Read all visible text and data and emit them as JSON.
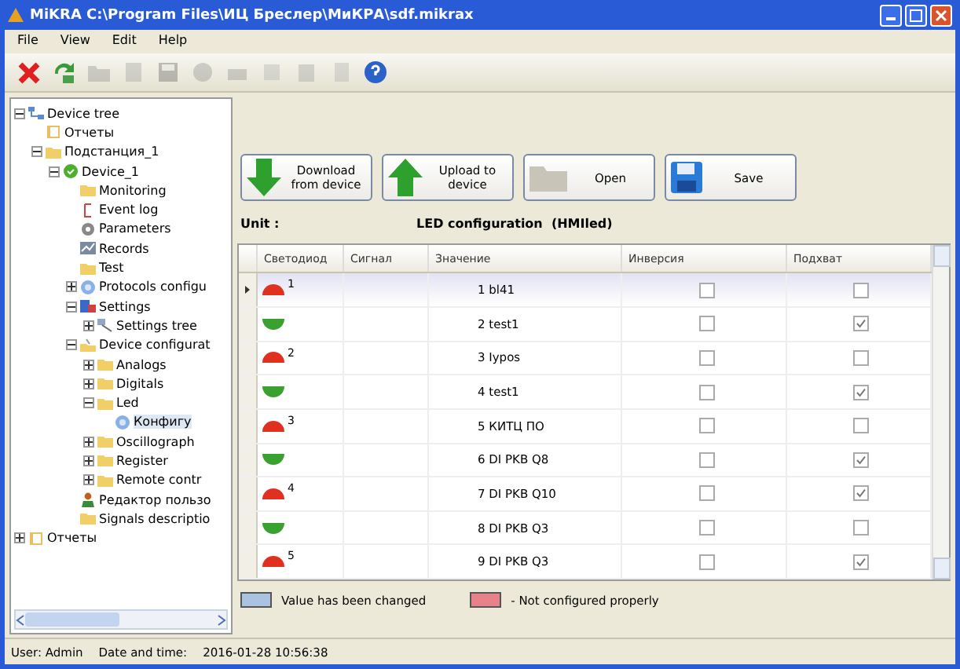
{
  "window": {
    "title": "MiKRA C:\\Program Files\\ИЦ Бреслер\\МиКРА\\sdf.mikrax"
  },
  "menu": [
    "File",
    "View",
    "Edit",
    "Help"
  ],
  "toolbar": [
    {
      "kind": "delete",
      "disabled": false
    },
    {
      "kind": "refresh",
      "disabled": false
    },
    {
      "kind": "open",
      "disabled": true
    },
    {
      "kind": "edit",
      "disabled": true
    },
    {
      "kind": "save",
      "disabled": true
    },
    {
      "kind": "back",
      "disabled": true
    },
    {
      "kind": "print",
      "disabled": true
    },
    {
      "kind": "copy",
      "disabled": true
    },
    {
      "kind": "paste",
      "disabled": true
    },
    {
      "kind": "page",
      "disabled": true
    },
    {
      "kind": "help",
      "disabled": false
    }
  ],
  "tree": [
    {
      "label": "Device tree",
      "kind": "network",
      "expanded": true,
      "children": [
        {
          "label": "Отчеты",
          "kind": "report"
        },
        {
          "label": "Подстанция_1",
          "kind": "folder",
          "expanded": true,
          "children": [
            {
              "label": "Device_1",
              "kind": "device",
              "expanded": true,
              "children": [
                {
                  "label": "Monitoring",
                  "kind": "folder"
                },
                {
                  "label": "Event log",
                  "kind": "log"
                },
                {
                  "label": "Parameters",
                  "kind": "gear"
                },
                {
                  "label": "Records",
                  "kind": "records"
                },
                {
                  "label": "Test",
                  "kind": "folder"
                },
                {
                  "label": "Protocols configu",
                  "kind": "globe",
                  "expanded": false
                },
                {
                  "label": "Settings",
                  "kind": "settings",
                  "expanded": true,
                  "children": [
                    {
                      "label": "Settings tree",
                      "kind": "tool",
                      "expanded": false
                    }
                  ]
                },
                {
                  "label": "Device configurat",
                  "kind": "config",
                  "expanded": true,
                  "children": [
                    {
                      "label": "Analogs",
                      "kind": "folder",
                      "expanded": false
                    },
                    {
                      "label": "Digitals",
                      "kind": "folder",
                      "expanded": false
                    },
                    {
                      "label": "Led",
                      "kind": "folder",
                      "expanded": true,
                      "children": [
                        {
                          "label": "Конфигу",
                          "kind": "globe",
                          "selected": true
                        }
                      ]
                    },
                    {
                      "label": "Oscillograph",
                      "kind": "folder",
                      "expanded": false
                    },
                    {
                      "label": "Register",
                      "kind": "folder",
                      "expanded": false
                    },
                    {
                      "label": "Remote contr",
                      "kind": "folder",
                      "expanded": false
                    }
                  ]
                },
                {
                  "label": "Редактор пользо",
                  "kind": "user"
                },
                {
                  "label": "Signals descriptio",
                  "kind": "folder"
                }
              ]
            }
          ]
        }
      ]
    },
    {
      "label": "Отчеты",
      "kind": "report",
      "expanded": false
    }
  ],
  "buttons": [
    {
      "kind": "download",
      "label": "Download from device"
    },
    {
      "kind": "upload",
      "label": "Upload to device"
    },
    {
      "kind": "open",
      "label": "Open"
    },
    {
      "kind": "save",
      "label": "Save"
    }
  ],
  "unit_label": "Unit :",
  "config_title": "LED configuration  (HMIled)",
  "table": {
    "columns": [
      "Светодиод",
      "Сигнал",
      "Значение",
      "Инверсия",
      "Подхват"
    ],
    "rows": [
      {
        "led": "1",
        "kind": "upper",
        "color": "#e03020",
        "value": "1 bl41",
        "inversion": false,
        "latch": false,
        "selected": true
      },
      {
        "led": "",
        "kind": "lower",
        "color": "#3aa030",
        "value": "2 test1",
        "inversion": false,
        "latch": true,
        "selected": false
      },
      {
        "led": "2",
        "kind": "upper",
        "color": "#e03020",
        "value": "3 Iypos",
        "inversion": false,
        "latch": false,
        "selected": false
      },
      {
        "led": "",
        "kind": "lower",
        "color": "#3aa030",
        "value": "4 test1",
        "inversion": false,
        "latch": true,
        "selected": false
      },
      {
        "led": "3",
        "kind": "upper",
        "color": "#e03020",
        "value": "5 КИТЦ ПО",
        "inversion": false,
        "latch": false,
        "selected": false
      },
      {
        "led": "",
        "kind": "lower",
        "color": "#3aa030",
        "value": "6 DI PKB Q8",
        "inversion": false,
        "latch": true,
        "selected": false
      },
      {
        "led": "4",
        "kind": "upper",
        "color": "#e03020",
        "value": "7 DI PKB Q10",
        "inversion": false,
        "latch": true,
        "selected": false
      },
      {
        "led": "",
        "kind": "lower",
        "color": "#3aa030",
        "value": "8 DI PKB Q3",
        "inversion": false,
        "latch": false,
        "selected": false
      },
      {
        "led": "5",
        "kind": "upper",
        "color": "#e03020",
        "value": "9 DI PKB Q3",
        "inversion": false,
        "latch": true,
        "selected": false
      }
    ]
  },
  "legend": [
    {
      "color": "#a9c3e0",
      "label": "Value has been changed"
    },
    {
      "color": "#e8828a",
      "label": "- Not configured properly"
    }
  ],
  "status_bar": {
    "user": "User: Admin",
    "datetime_label": "Date and time:",
    "datetime": "2016-01-28 10:56:38"
  }
}
